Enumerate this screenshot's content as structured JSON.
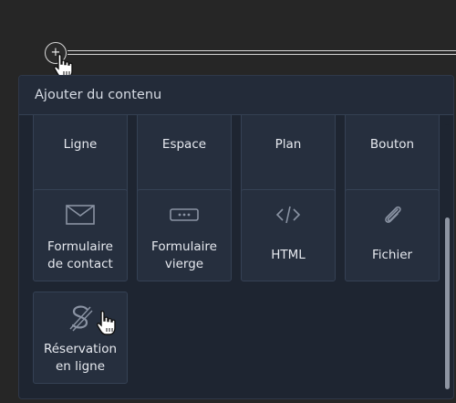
{
  "panel": {
    "title": "Ajouter du contenu"
  },
  "tiles_row1": [
    {
      "label": "Ligne"
    },
    {
      "label": "Espace"
    },
    {
      "label": "Plan"
    },
    {
      "label": "Bouton"
    }
  ],
  "tiles_row2": [
    {
      "line1": "Formulaire",
      "line2": "de contact",
      "icon": "envelope-icon"
    },
    {
      "line1": "Formulaire",
      "line2": "vierge",
      "icon": "blank-form-icon"
    },
    {
      "label": "HTML",
      "icon": "code-icon"
    },
    {
      "label": "Fichier",
      "icon": "paperclip-icon"
    }
  ],
  "tiles_row3": [
    {
      "line1": "Réservation",
      "line2": "en ligne",
      "icon": "booking-icon"
    }
  ],
  "insert": {
    "plus": "+"
  },
  "colors": {
    "panel_bg": "#1e2531",
    "tile_bg": "#262f3e",
    "icon": "#8a93a3",
    "text": "#e6e9ef"
  }
}
